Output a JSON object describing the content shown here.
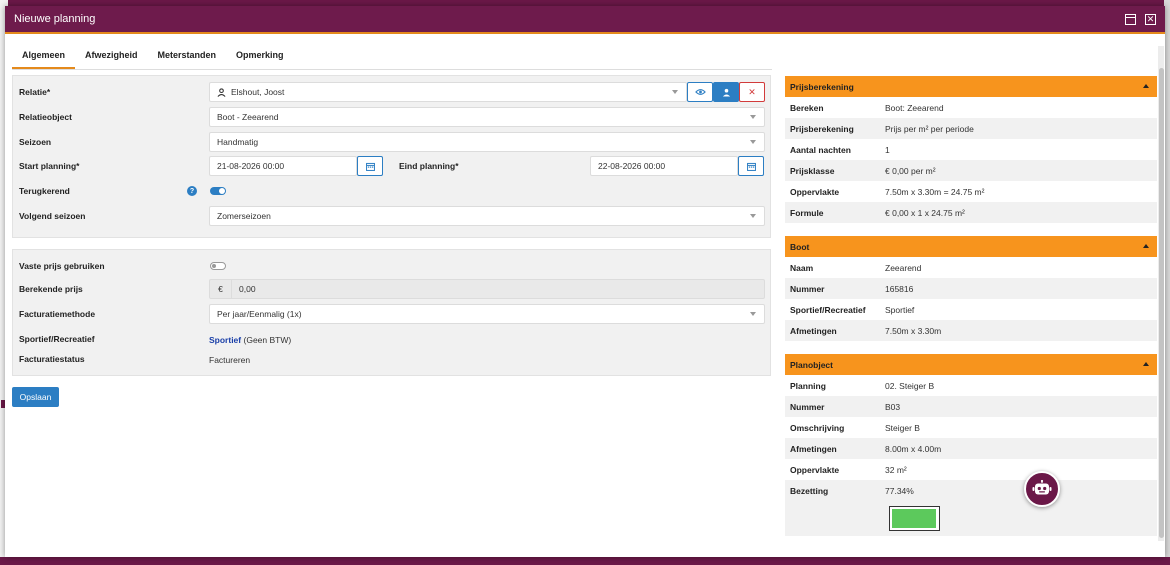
{
  "modal": {
    "title": "Nieuwe planning"
  },
  "tabs": [
    {
      "label": "Algemeen",
      "active": true
    },
    {
      "label": "Afwezigheid",
      "active": false
    },
    {
      "label": "Meterstanden",
      "active": false
    },
    {
      "label": "Opmerking",
      "active": false
    }
  ],
  "form": {
    "relatie": {
      "label": "Relatie*",
      "value": "Elshout, Joost"
    },
    "relatieobject": {
      "label": "Relatieobject",
      "value": "Boot - Zeearend"
    },
    "seizoen": {
      "label": "Seizoen",
      "value": "Handmatig"
    },
    "start_planning": {
      "label": "Start planning*",
      "value": "21-08-2026 00:00"
    },
    "eind_planning": {
      "label": "Eind planning*",
      "value": "22-08-2026 00:00"
    },
    "terugkerend": {
      "label": "Terugkerend",
      "on": true,
      "help": "?"
    },
    "volgend_seizoen": {
      "label": "Volgend seizoen",
      "value": "Zomerseizoen"
    },
    "vaste_prijs": {
      "label": "Vaste prijs gebruiken",
      "on": false
    },
    "berekende_prijs": {
      "label": "Berekende prijs",
      "currency": "€",
      "value": "0,00"
    },
    "facturatiemethode": {
      "label": "Facturatiemethode",
      "value": "Per jaar/Eenmalig (1x)"
    },
    "sportief": {
      "label": "Sportief/Recreatief",
      "link": "Sportief",
      "suffix": "(Geen BTW)"
    },
    "facturatiestatus": {
      "label": "Facturatiestatus",
      "value": "Factureren"
    },
    "save_label": "Opslaan"
  },
  "sidebar": {
    "prijsberekening": {
      "title": "Prijsberekening",
      "rows": [
        {
          "k": "Bereken",
          "v": "Boot: Zeearend"
        },
        {
          "k": "Prijsberekening",
          "v": "Prijs per m² per periode"
        },
        {
          "k": "Aantal nachten",
          "v": "1"
        },
        {
          "k": "Prijsklasse",
          "v": "€ 0,00 per m²"
        },
        {
          "k": "Oppervlakte",
          "v": "7.50m x 3.30m = 24.75 m²"
        },
        {
          "k": "Formule",
          "v": "€ 0,00 x 1 x 24.75 m²"
        }
      ]
    },
    "boot": {
      "title": "Boot",
      "rows": [
        {
          "k": "Naam",
          "v": "Zeearend"
        },
        {
          "k": "Nummer",
          "v": "165816"
        },
        {
          "k": "Sportief/Recreatief",
          "v": "Sportief"
        },
        {
          "k": "Afmetingen",
          "v": "7.50m x 3.30m"
        }
      ]
    },
    "planobject": {
      "title": "Planobject",
      "rows": [
        {
          "k": "Planning",
          "v": "02. Steiger B"
        },
        {
          "k": "Nummer",
          "v": "B03"
        },
        {
          "k": "Omschrijving",
          "v": "Steiger B"
        },
        {
          "k": "Afmetingen",
          "v": "8.00m x 4.00m"
        },
        {
          "k": "Oppervlakte",
          "v": "32 m²"
        },
        {
          "k": "Bezetting",
          "v": "77.34%"
        }
      ],
      "occupancy_fraction": 0.7734
    }
  },
  "colors": {
    "header": "#6e1b4c",
    "accent": "#f7941d",
    "primary": "#2c7ec3",
    "occupancy": "#5cc95c"
  }
}
